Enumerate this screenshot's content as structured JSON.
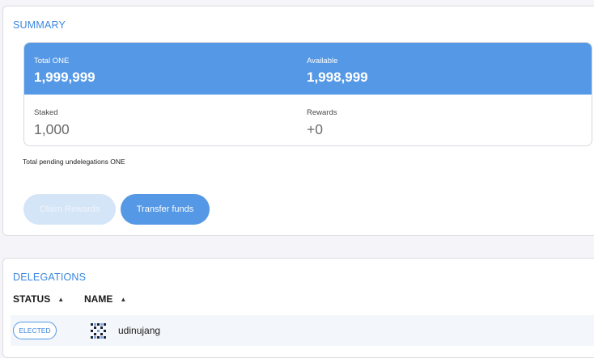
{
  "summary": {
    "title": "SUMMARY",
    "total_label": "Total ONE",
    "total_value": "1,999,999",
    "available_label": "Available",
    "available_value": "1,998,999",
    "staked_label": "Staked",
    "staked_value": "1,000",
    "rewards_label": "Rewards",
    "rewards_value": "+0",
    "pending_text": "Total pending undelegations ONE",
    "claim_label": "Claim Rewards",
    "transfer_label": "Transfer funds"
  },
  "delegations": {
    "title": "DELEGATIONS",
    "columns": [
      {
        "label": "STATUS",
        "sort_icon": "sort-up-icon"
      },
      {
        "label": "NAME",
        "sort_icon": "sort-up-icon"
      }
    ],
    "rows": [
      {
        "status": "ELECTED",
        "name": "udinujang",
        "avatar_icon": "identicon-icon"
      }
    ]
  },
  "colors": {
    "accent": "#5598e5",
    "accent_text": "#3a86e0",
    "disabled_button": "#d5e5f8",
    "background": "#f4f4f9"
  }
}
